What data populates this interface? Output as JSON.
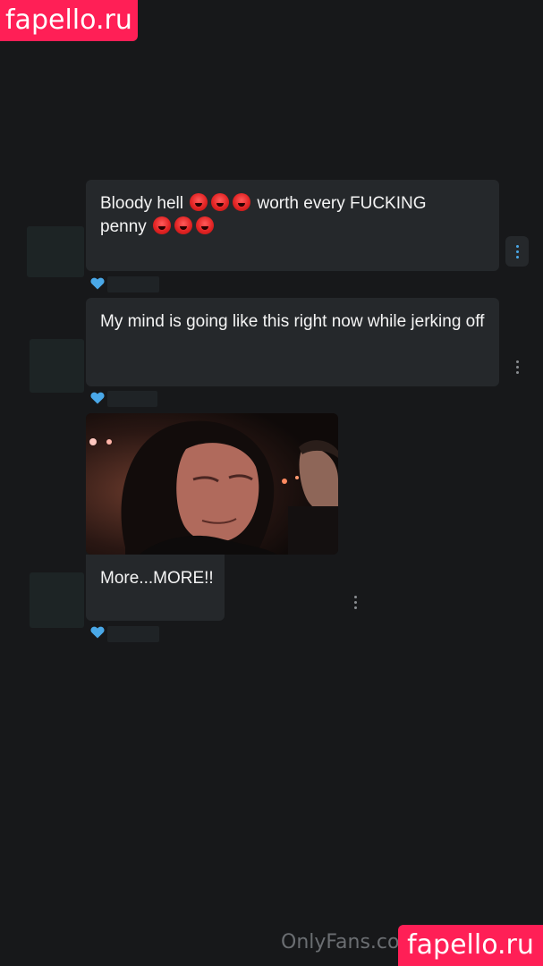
{
  "watermark": {
    "top_text": "fapello.ru",
    "bottom_text": "fapello.ru"
  },
  "footer": {
    "site_text": "OnlyFans.co"
  },
  "messages": [
    {
      "text_before_emoji": "Bloody hell",
      "text_middle": "worth every FUCKING",
      "text_after": "penny",
      "emoji": "enraged-face-emoji"
    },
    {
      "text": "My mind is going like this right now while jerking off"
    },
    {
      "caption": "More...MORE!!",
      "media_icon": "gif-image"
    }
  ],
  "colors": {
    "background": "#17181a",
    "bubble": "#25282b",
    "accent_blue": "#4aa8e8",
    "watermark": "#ff1f56"
  }
}
